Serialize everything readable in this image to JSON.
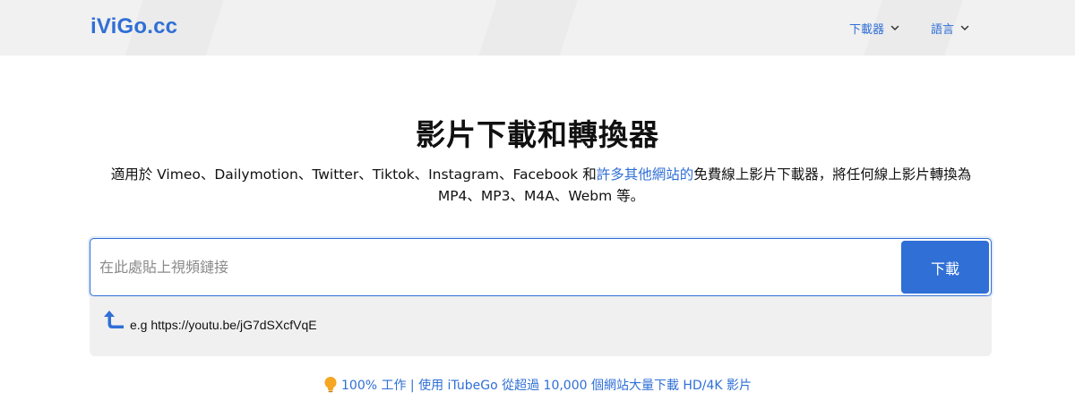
{
  "header": {
    "logo": "iViGo.cc",
    "nav": {
      "downloader": "下載器",
      "language": "語言"
    }
  },
  "main": {
    "title": "影片下載和轉換器",
    "description": {
      "part1": "適用於 Vimeo、Dailymotion、Twitter、Tiktok、Instagram、Facebook 和",
      "link": "許多其他網站的",
      "part2": "免費線上影片下載器，將任何線上影片轉換為 MP4、MP3、M4A、Webm 等。"
    },
    "search": {
      "placeholder": "在此處貼上視頻鏈接",
      "value": "",
      "button_label": "下載"
    },
    "example": "e.g https://youtu.be/jG7dSXcfVqE",
    "promo": "100% 工作 | 使用 iTubeGo 從超過 10,000 個網站大量下載 HD/4K 影片"
  },
  "colors": {
    "accent": "#2f6fd6",
    "header_bg": "#f1f1f1",
    "example_bg": "#f0f0f0",
    "bulb": "#f5a623"
  },
  "icons": [
    "chevron-down-icon",
    "return-arrow-icon",
    "lightbulb-icon"
  ]
}
